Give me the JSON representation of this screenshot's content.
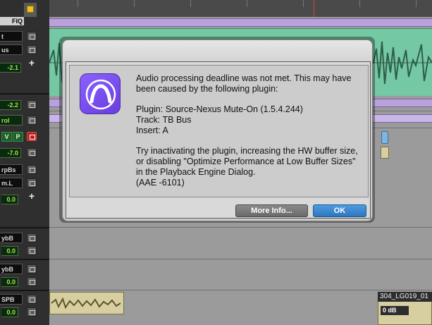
{
  "dialog": {
    "message": "Audio processing deadline was not met. This may have been caused by the following plugin:",
    "plugin_line": "Plugin: Source-Nexus Mute-On (1.5.4.244)",
    "track_line": "Track: TB Bus",
    "insert_line": "Insert: A",
    "advice": "Try inactivating the plugin, increasing the HW buffer size, or disabling \"Optimize Performance at Low Buffer Sizes\" in the Playback Engine Dialog.",
    "error_code": "(AAE -6101)",
    "more_info_label": "More Info...",
    "ok_label": "OK",
    "icon": "pro-tools-app-icon",
    "ok_color": "#3a86d0"
  },
  "strip": {
    "fiq_label": "FIQ",
    "out_label": "t",
    "bus_label": "us",
    "vol1": "-2.1",
    "vol2": "-2.2",
    "vol_label": "rol",
    "v_label": "V",
    "p_label": "P",
    "vol3": "-7.0",
    "send_label": "rpBs",
    "output_label": "m.L",
    "pan1": "0.0",
    "reverb1": "ybB",
    "pan2": "0.0",
    "reverb2": "ybB",
    "pan3": "0.0",
    "spb_label": "SPB",
    "pan4": "0.0"
  },
  "clip": {
    "name": "304_LG019_01",
    "gain": "0 dB"
  },
  "colors": {
    "waveform": "#74c8a4",
    "automation": "#b9a2dc",
    "audio_clip": "#d8cfa0",
    "record_button": "#b4231f"
  }
}
